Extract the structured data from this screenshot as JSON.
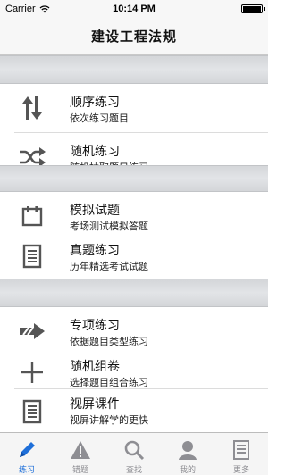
{
  "status_bar": {
    "carrier": "Carrier",
    "time": "10:14 PM"
  },
  "nav": {
    "title": "建设工程法规"
  },
  "sections": [
    {
      "items": [
        {
          "title": "顺序练习",
          "subtitle": "依次练习题目",
          "icon": "up-down-arrows-icon"
        },
        {
          "title": "随机练习",
          "subtitle": "随机抽取题目练习",
          "icon": "shuffle-icon"
        }
      ]
    },
    {
      "items": [
        {
          "title": "模拟试题",
          "subtitle": "考场测试模拟答题",
          "icon": "calendar-icon"
        },
        {
          "title": "真题练习",
          "subtitle": "历年精选考试试题",
          "icon": "document-lines-icon"
        }
      ]
    },
    {
      "items": [
        {
          "title": "专项练习",
          "subtitle": "依据题目类型练习",
          "icon": "forward-arrow-icon"
        },
        {
          "title": "随机组卷",
          "subtitle": "选择题目组合练习",
          "icon": "plus-icon"
        },
        {
          "title": "视屏课件",
          "subtitle": "视屏讲解学的更快",
          "icon": "document-lines-icon"
        }
      ]
    }
  ],
  "tabs": [
    {
      "label": "练习",
      "icon": "pencil-icon",
      "active": true
    },
    {
      "label": "错题",
      "icon": "warning-icon",
      "active": false
    },
    {
      "label": "查找",
      "icon": "search-icon",
      "active": false
    },
    {
      "label": "我的",
      "icon": "person-icon",
      "active": false
    },
    {
      "label": "更多",
      "icon": "list-icon",
      "active": false
    }
  ],
  "colors": {
    "accent": "#1e6fd9",
    "icon_gray": "#555555",
    "tab_inactive": "#8e8e93"
  }
}
